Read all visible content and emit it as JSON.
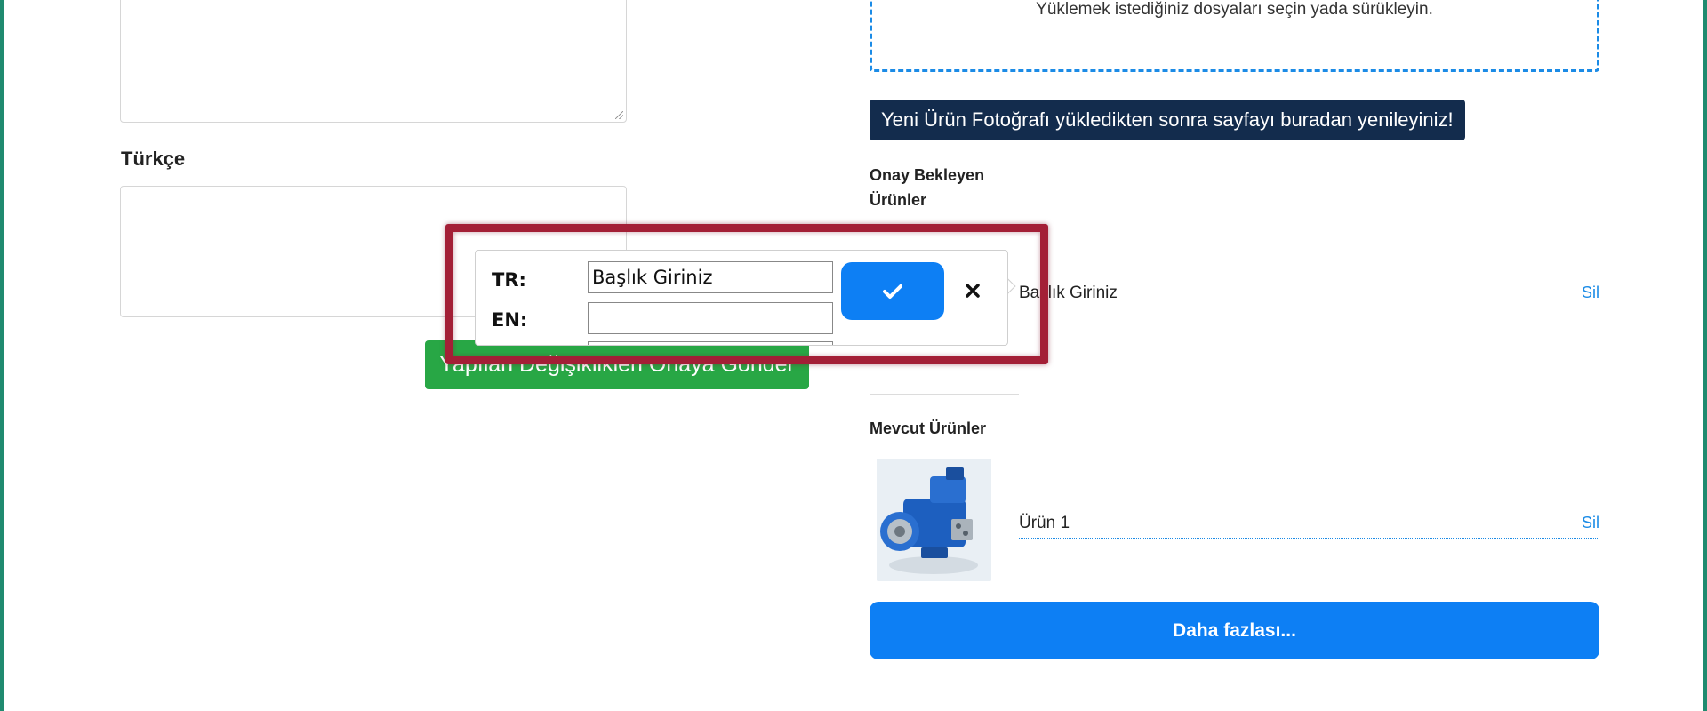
{
  "left": {
    "section_label": "Türkçe",
    "submit_button": "Yapılan Değişiklikleri Onaya Gönder"
  },
  "right": {
    "dropzone_text": "Yüklemek istediğiniz dosyaları seçin yada sürükleyin.",
    "refresh_banner": "Yeni Ürün Fotoğrafı yükledikten sonra sayfayı buradan yenileyiniz!",
    "pending_title": "Onay Bekleyen Ürünler",
    "pending_items": [
      {
        "name": "Başlık Giriniz",
        "delete_label": "Sil"
      }
    ],
    "current_title": "Mevcut Ürünler",
    "current_items": [
      {
        "name": "Ürün 1",
        "delete_label": "Sil",
        "image": "hydraulic-pump-photo"
      }
    ],
    "more_button": "Daha fazlası..."
  },
  "popover": {
    "tr_label": "TR:",
    "tr_value": "Başlık Giriniz",
    "en_label": "EN:",
    "en_value": "",
    "confirm_icon": "check-icon",
    "cancel_icon": "close-icon"
  },
  "colors": {
    "accent_blue": "#0d7ff4",
    "banner_navy": "#132c4d",
    "submit_green": "#28a745",
    "highlight_red": "#a31f36"
  }
}
